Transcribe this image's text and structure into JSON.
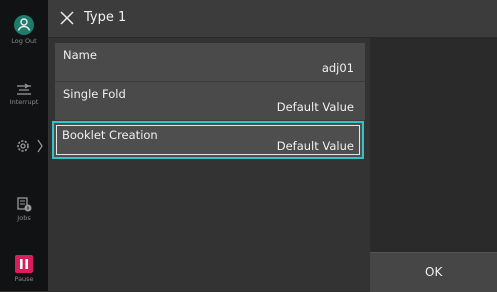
{
  "sidebar": {
    "items": [
      {
        "label": "Log Out",
        "icon": "user-logout-icon"
      },
      {
        "label": "Interrupt",
        "icon": "interrupt-icon"
      },
      {
        "label": "",
        "icon": "settings-gear-icon"
      },
      {
        "label": "Jobs",
        "icon": "jobs-icon"
      },
      {
        "label": "Pause",
        "icon": "pause-icon"
      }
    ]
  },
  "header": {
    "title": "Type 1",
    "close_icon": "close-icon"
  },
  "list": {
    "items": [
      {
        "name": "Name",
        "value": "adj01"
      },
      {
        "name": "Single Fold",
        "value": "Default Value"
      },
      {
        "name": "Booklet Creation",
        "value": "Default Value"
      }
    ]
  },
  "buttons": {
    "ok_label": "OK"
  },
  "colors": {
    "accent": "#32c4c4",
    "pause": "#d81f5c",
    "user": "#1e7c6c"
  }
}
